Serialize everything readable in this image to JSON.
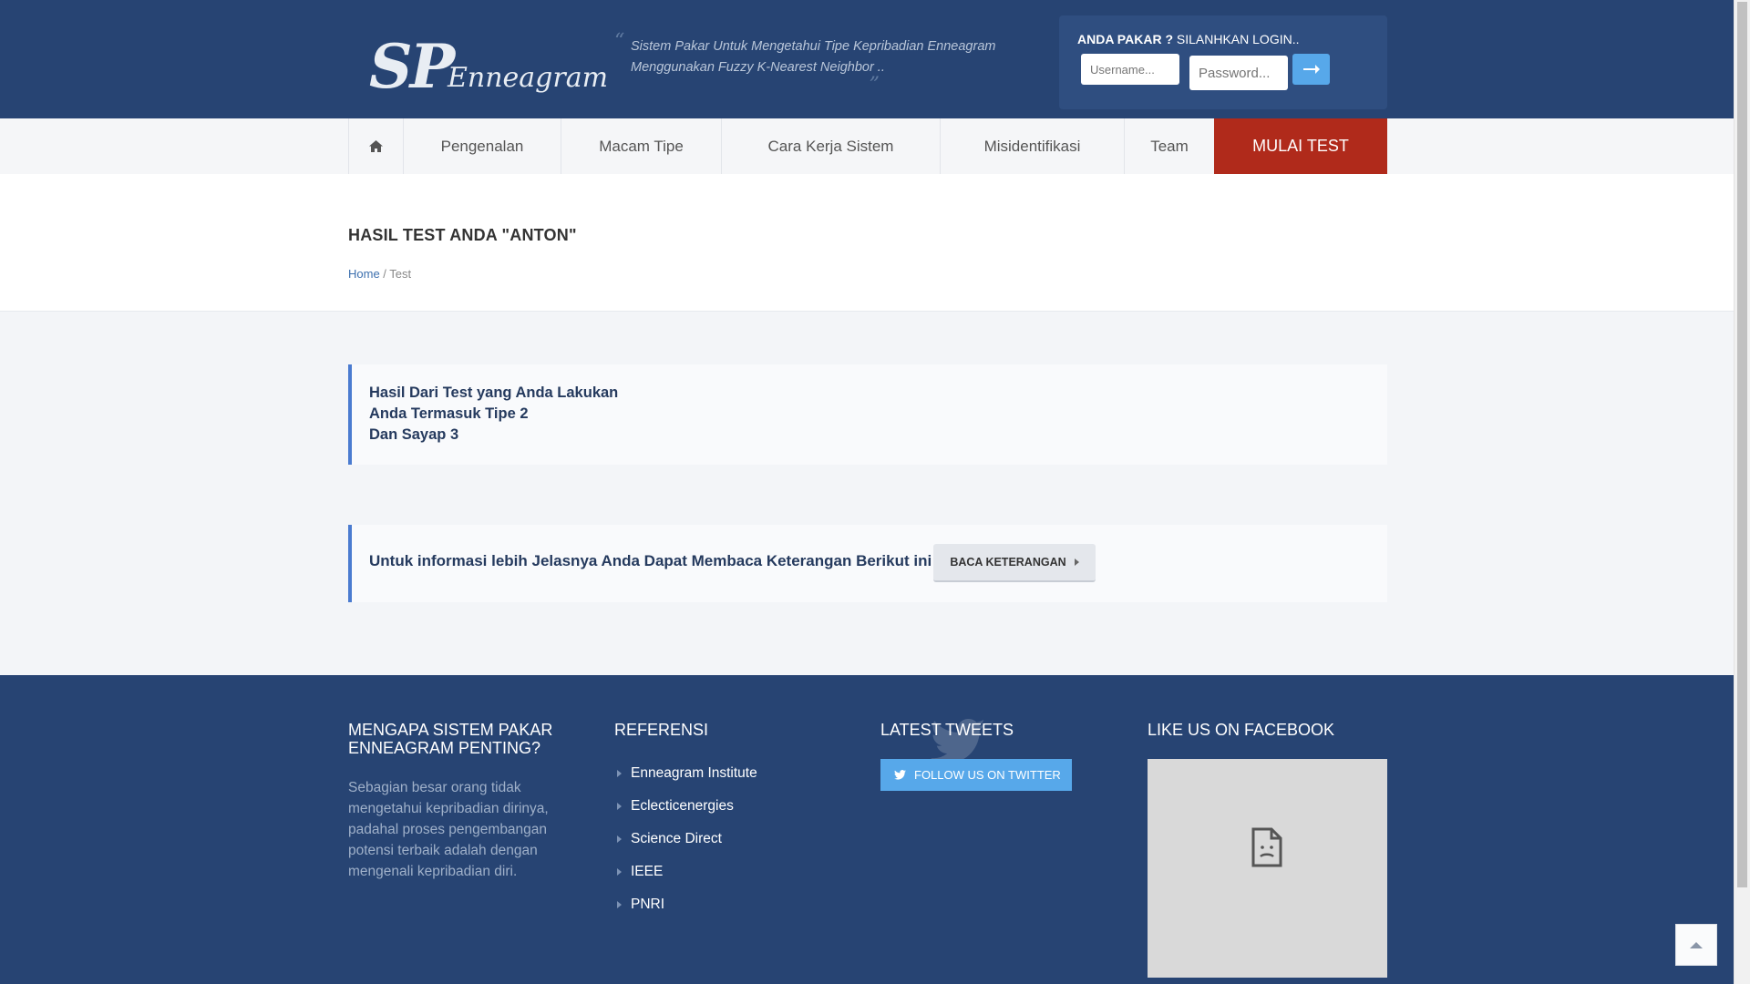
{
  "header": {
    "logo_sp": "SP",
    "logo_word": "Enneagram",
    "tagline": "Sistem Pakar Untuk Mengetahui Tipe Kepribadian Enneagram Menggunakan Fuzzy K-Nearest Neighbor ..",
    "login": {
      "title_bold": "ANDA PAKAR ?",
      "title_rest": " SILANHKAN LOGIN..",
      "username_placeholder": "Username...",
      "password_placeholder": "Password..."
    }
  },
  "nav": {
    "items": [
      "Pengenalan",
      "Macam Tipe",
      "Cara Kerja Sistem",
      "Misidentifikasi",
      "Team"
    ],
    "cta": "MULAI TEST"
  },
  "page": {
    "title": "HASIL TEST ANDA \"ANTON\"",
    "breadcrumb_home": "Home",
    "breadcrumb_sep": " / ",
    "breadcrumb_current": "Test"
  },
  "result": {
    "line1": "Hasil Dari Test yang Anda Lakukan",
    "line2": "Anda Termasuk Tipe 2",
    "line3": "Dan Sayap 3"
  },
  "info": {
    "text": "Untuk informasi lebih Jelasnya Anda Dapat Membaca Keterangan Berikut ini",
    "button": "BACA KETERANGAN"
  },
  "footer": {
    "col1_title": "MENGAPA SISTEM PAKAR ENNEAGRAM PENTING?",
    "col1_text": "Sebagian besar orang tidak mengetahui kepribadian dirinya, padahal proses pengembangan potensi terbaik adalah dengan mengenali kepribadian diri.",
    "col2_title": "REFERENSI",
    "references": [
      "Enneagram Institute",
      "Eclecticenergies",
      "Science Direct",
      "IEEE",
      "PNRI"
    ],
    "col3_title": "LATEST TWEETS",
    "twitter_button": "FOLLOW US ON TWITTER",
    "col4_title": "LIKE US ON FACEBOOK"
  },
  "colors": {
    "header_bg": "#274473",
    "cta_bg": "#b02a1b",
    "accent_blue": "#57a8ea",
    "callout_border": "#4a7bd0"
  }
}
